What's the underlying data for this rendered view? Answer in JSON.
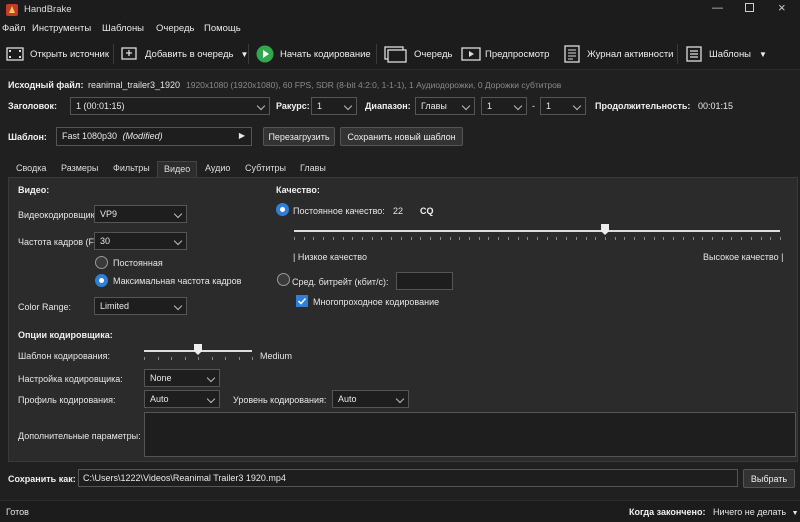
{
  "window": {
    "title": "HandBrake"
  },
  "menu": [
    "Файл",
    "Инструменты",
    "Шаблоны",
    "Очередь",
    "Помощь"
  ],
  "toolbar": {
    "open_source": "Открыть источник",
    "add_to_queue": "Добавить в очередь",
    "start_encode": "Начать кодирование",
    "queue": "Очередь",
    "preview": "Предпросмотр",
    "activity_log": "Журнал активности",
    "presets": "Шаблоны"
  },
  "source": {
    "label": "Исходный файл:",
    "file": "reanimal_trailer3_1920",
    "info": "1920x1080 (1920x1080), 60 FPS, SDR (8-bit 4:2:0, 1-1-1), 1 Аудиодорожки, 0 Дорожки субтитров"
  },
  "title_row": {
    "title_label": "Заголовок:",
    "title_value": "1  (00:01:15)",
    "angle_label": "Ракурс:",
    "angle_value": "1",
    "range_label": "Диапазон:",
    "range_type": "Главы",
    "range_start": "1",
    "range_dash": "-",
    "range_end": "1",
    "duration_label": "Продолжительность:",
    "duration_value": "00:01:15"
  },
  "preset": {
    "label": "Шаблон:",
    "value": "Fast 1080p30",
    "modified": "(Modified)",
    "reload": "Перезагрузить",
    "save_new": "Сохранить новый шаблон"
  },
  "tabs": [
    "Сводка",
    "Размеры",
    "Фильтры",
    "Видео",
    "Аудио",
    "Субтитры",
    "Главы"
  ],
  "video": {
    "section": "Видео:",
    "codec_label": "Видеокодировщик",
    "codec_value": "VP9",
    "fps_label": "Частота кадров (FP",
    "fps_value": "30",
    "constant": "Постоянная",
    "peak": "Максимальная частота кадров",
    "color_range_label": "Color Range:",
    "color_range_value": "Limited"
  },
  "quality": {
    "section": "Качество:",
    "cq_label": "Постоянное качество:",
    "cq_value": "22",
    "cq_unit": "CQ",
    "slider_fraction": 0.64,
    "low": "| Низкое качество",
    "high": "Высокое качество |",
    "bitrate_label": "Сред. битрейт (кбит/с):",
    "multipass": "Многопроходное кодирование"
  },
  "encoder": {
    "section": "Опции кодировщика:",
    "preset_label": "Шаблон кодирования:",
    "preset_value": "Medium",
    "preset_fraction": 0.5,
    "tune_label": "Настройка кодировщика:",
    "tune_value": "None",
    "profile_label": "Профиль кодирования:",
    "profile_value": "Auto",
    "level_label": "Уровень кодирования:",
    "level_value": "Auto",
    "extra_label": "Дополнительные параметры:"
  },
  "save": {
    "label": "Сохранить как:",
    "path": "C:\\Users\\1222\\Videos\\Reanimal Trailer3 1920.mp4",
    "browse": "Выбрать"
  },
  "status": {
    "ready": "Готов",
    "when_done_label": "Когда закончено:",
    "when_done_value": "Ничего не делать"
  },
  "colors": {
    "accent": "#2f7fd8",
    "start_green": "#2fa84f"
  }
}
